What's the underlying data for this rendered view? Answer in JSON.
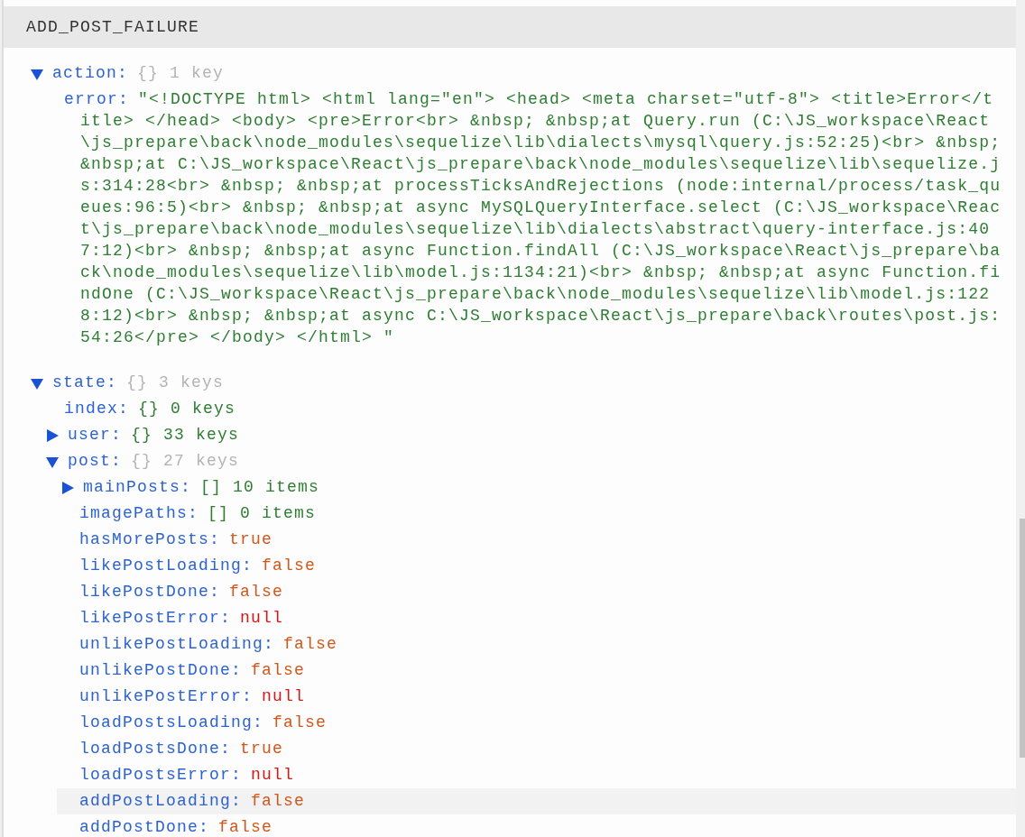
{
  "header": {
    "title": "ADD_POST_FAILURE"
  },
  "sections": [
    {
      "key": "action:",
      "kind": "object",
      "type": "{}",
      "count": "1 key",
      "expanded": true,
      "children": [
        {
          "key": "error:",
          "kind": "string",
          "value": "\"<!DOCTYPE html> <html lang=\"en\"> <head> <meta charset=\"utf-8\"> <title>Error</title> </head> <body> <pre>Error<br> &nbsp; &nbsp;at Query.run (C:\\JS_workspace\\React\\js_prepare\\back\\node_modules\\sequelize\\lib\\dialects\\mysql\\query.js:52:25)<br> &nbsp; &nbsp;at C:\\JS_workspace\\React\\js_prepare\\back\\node_modules\\sequelize\\lib\\sequelize.js:314:28<br> &nbsp; &nbsp;at processTicksAndRejections (node:internal/process/task_queues:96:5)<br> &nbsp; &nbsp;at async MySQLQueryInterface.select (C:\\JS_workspace\\React\\js_prepare\\back\\node_modules\\sequelize\\lib\\dialects\\abstract\\query-interface.js:407:12)<br> &nbsp; &nbsp;at async Function.findAll (C:\\JS_workspace\\React\\js_prepare\\back\\node_modules\\sequelize\\lib\\model.js:1134:21)<br> &nbsp; &nbsp;at async Function.findOne (C:\\JS_workspace\\React\\js_prepare\\back\\node_modules\\sequelize\\lib\\model.js:1228:12)<br> &nbsp; &nbsp;at async C:\\JS_workspace\\React\\js_prepare\\back\\routes\\post.js:54:26</pre> </body> </html> \""
        }
      ]
    },
    {
      "key": "state:",
      "kind": "object",
      "type": "{}",
      "count": "3 keys",
      "expanded": true,
      "children": [
        {
          "key": "index:",
          "kind": "object",
          "type": "{}",
          "count": "0 keys"
        },
        {
          "key": "user:",
          "kind": "object",
          "type": "{}",
          "count": "33 keys",
          "expanded": false
        },
        {
          "key": "post:",
          "kind": "object",
          "type": "{}",
          "count": "27 keys",
          "expanded": true,
          "children": [
            {
              "key": "mainPosts:",
              "kind": "object",
              "type": "[]",
              "count": "10 items",
              "expanded": false,
              "highlighted": false
            },
            {
              "key": "imagePaths:",
              "kind": "object",
              "type": "[]",
              "count": "0 items",
              "highlighted": false
            },
            {
              "key": "hasMorePosts:",
              "kind": "boolean",
              "value": "true",
              "highlighted": false
            },
            {
              "key": "likePostLoading:",
              "kind": "boolean",
              "value": "false",
              "highlighted": false
            },
            {
              "key": "likePostDone:",
              "kind": "boolean",
              "value": "false",
              "highlighted": false
            },
            {
              "key": "likePostError:",
              "kind": "null",
              "value": "null",
              "highlighted": false
            },
            {
              "key": "unlikePostLoading:",
              "kind": "boolean",
              "value": "false",
              "highlighted": false
            },
            {
              "key": "unlikePostDone:",
              "kind": "boolean",
              "value": "false",
              "highlighted": false
            },
            {
              "key": "unlikePostError:",
              "kind": "null",
              "value": "null",
              "highlighted": false
            },
            {
              "key": "loadPostsLoading:",
              "kind": "boolean",
              "value": "false",
              "highlighted": false
            },
            {
              "key": "loadPostsDone:",
              "kind": "boolean",
              "value": "true",
              "highlighted": false
            },
            {
              "key": "loadPostsError:",
              "kind": "null",
              "value": "null",
              "highlighted": false
            },
            {
              "key": "addPostLoading:",
              "kind": "boolean",
              "value": "false",
              "highlighted": true
            },
            {
              "key": "addPostDone:",
              "kind": "boolean",
              "value": "false",
              "highlighted": false
            }
          ]
        }
      ]
    }
  ]
}
